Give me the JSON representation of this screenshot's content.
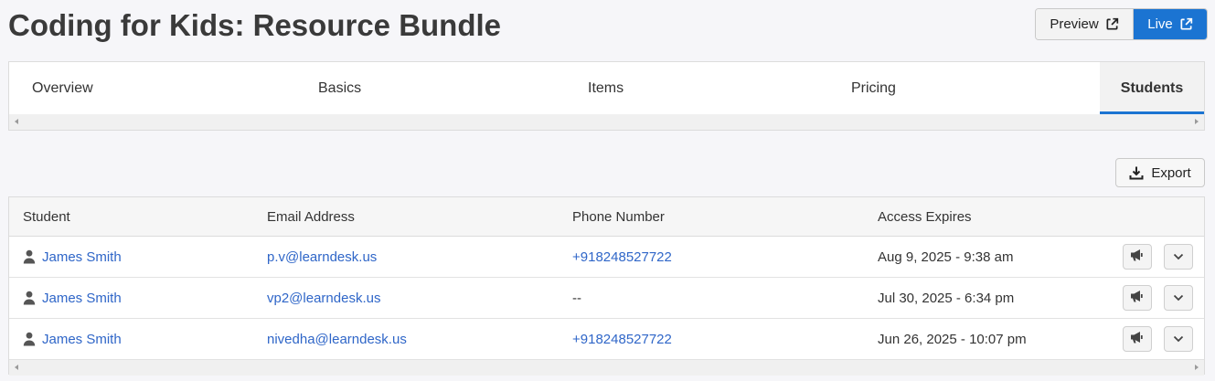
{
  "page": {
    "title": "Coding for Kids: Resource Bundle"
  },
  "header_buttons": {
    "preview_label": "Preview",
    "live_label": "Live"
  },
  "tabs": [
    {
      "label": "Overview"
    },
    {
      "label": "Basics"
    },
    {
      "label": "Items"
    },
    {
      "label": "Pricing"
    },
    {
      "label": "Students",
      "active": true
    }
  ],
  "toolbar": {
    "export_label": "Export"
  },
  "table": {
    "columns": [
      "Student",
      "Email Address",
      "Phone Number",
      "Access Expires"
    ],
    "rows": [
      {
        "student": "James Smith",
        "email": "p.v@learndesk.us",
        "phone": "+918248527722",
        "expires": "Aug 9, 2025 - 9:38 am"
      },
      {
        "student": "James Smith",
        "email": "vp2@learndesk.us",
        "phone": "--",
        "expires": "Jul 30, 2025 - 6:34 pm"
      },
      {
        "student": "James Smith",
        "email": "nivedha@learndesk.us",
        "phone": "+918248527722",
        "expires": "Jun 26, 2025 - 10:07 pm"
      }
    ]
  },
  "colors": {
    "accent": "#1b74d2",
    "link": "#2f66c8"
  },
  "icons": {
    "preview": "external-link-icon",
    "live": "external-link-icon",
    "export": "download-icon",
    "student": "user-icon",
    "announce": "megaphone-icon",
    "expand": "chevron-down-icon"
  }
}
